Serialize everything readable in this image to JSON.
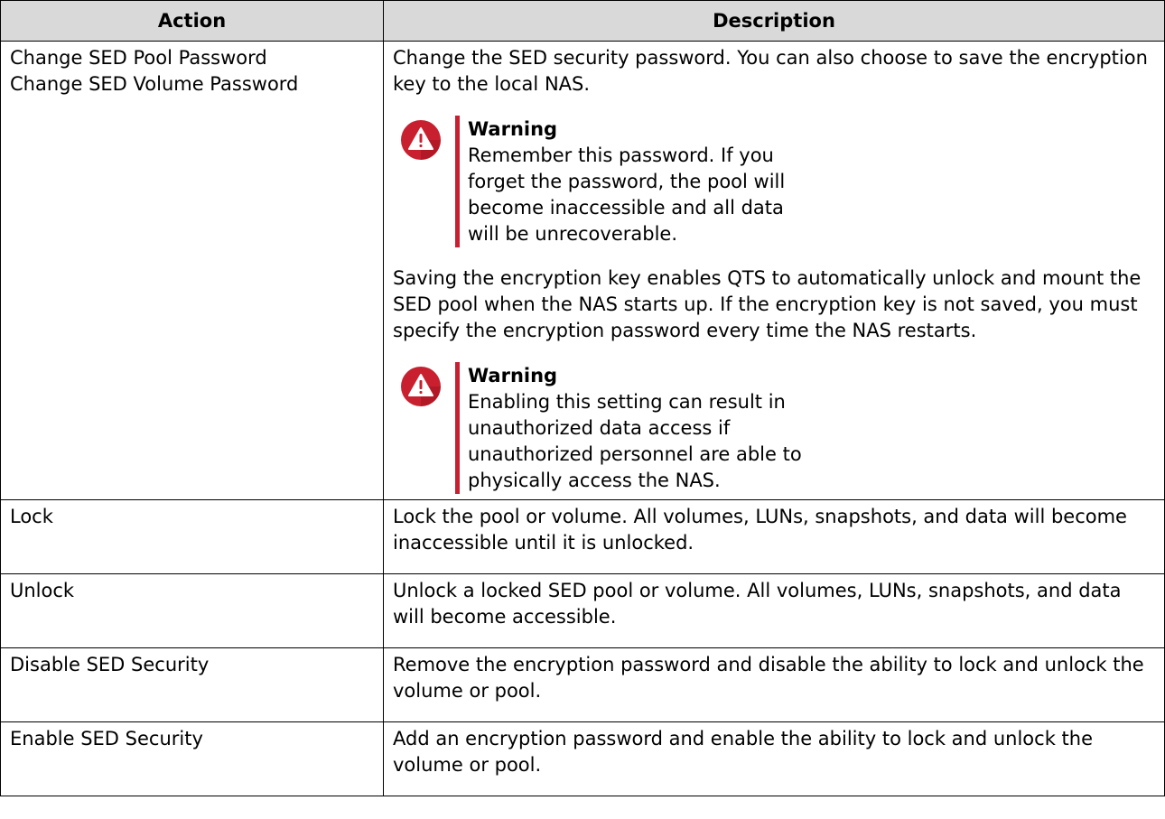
{
  "table": {
    "headers": {
      "action": "Action",
      "description": "Description"
    },
    "rows": [
      {
        "actions": [
          "Change SED Pool Password",
          "Change SED Volume Password"
        ],
        "para1": "Change the SED security password. You can also choose to save the encryption key to the local NAS.",
        "warning1": {
          "title": "Warning",
          "text": "Remember this password. If you forget the password, the pool will become inaccessible and all data will be unrecoverable."
        },
        "para2": "Saving the encryption key enables QTS to automatically unlock and mount the SED pool when the NAS starts up. If the encryption key is not saved, you must specify the encryption password every time the NAS restarts.",
        "warning2": {
          "title": "Warning",
          "text": "Enabling this setting can result in unauthorized data access if unauthorized personnel are able to physically access the NAS."
        }
      },
      {
        "action": "Lock",
        "description": "Lock the pool or volume. All volumes, LUNs, snapshots, and data will become inaccessible until it is unlocked."
      },
      {
        "action": "Unlock",
        "description": "Unlock a locked SED pool or volume. All volumes, LUNs, snapshots, and data will become accessible."
      },
      {
        "action": "Disable SED Security",
        "description": "Remove the encryption password and disable the ability to lock and unlock the volume or pool."
      },
      {
        "action": "Enable SED Security",
        "description": "Add an encryption password and enable the ability to lock and unlock the volume or pool."
      }
    ]
  },
  "colors": {
    "header_bg": "#d9d9d9",
    "warning_accent": "#c8202f",
    "border": "#000000"
  },
  "icons": {
    "warning": "warning-triangle-icon"
  }
}
